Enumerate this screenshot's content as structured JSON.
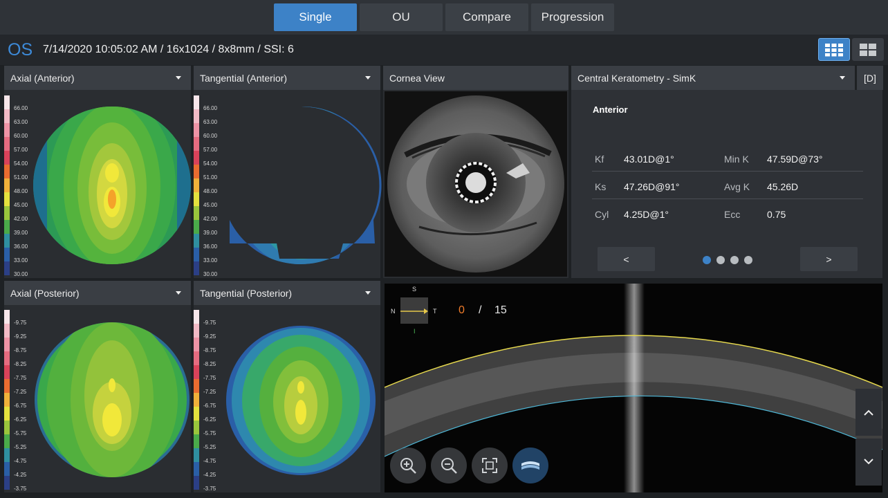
{
  "tabs": [
    {
      "label": "Single",
      "active": true
    },
    {
      "label": "OU",
      "active": false
    },
    {
      "label": "Compare",
      "active": false
    },
    {
      "label": "Progression",
      "active": false
    }
  ],
  "eye": "OS",
  "scan_info": "7/14/2020 10:05:02 AM / 16x1024 / 8x8mm / SSI: 6",
  "maps": {
    "axial_anterior": "Axial (Anterior)",
    "tangential_anterior": "Tangential (Anterior)",
    "axial_posterior": "Axial (Posterior)",
    "tangential_posterior": "Tangential (Posterior)"
  },
  "anterior_scale": [
    "66.00",
    "63.00",
    "60.00",
    "57.00",
    "54.00",
    "51.00",
    "48.00",
    "45.00",
    "42.00",
    "39.00",
    "36.00",
    "33.00",
    "30.00"
  ],
  "posterior_scale": [
    "-9.75",
    "-9.25",
    "-8.75",
    "-8.25",
    "-7.75",
    "-7.25",
    "-6.75",
    "-6.25",
    "-5.75",
    "-5.25",
    "-4.75",
    "-4.25",
    "-3.75"
  ],
  "cornea_view": "Cornea View",
  "keratometry": {
    "dropdown": "Central Keratometry - SimK",
    "d_button": "[D]",
    "section": "Anterior",
    "rows": [
      {
        "l1": "Kf",
        "v1": "43.01D@1°",
        "l2": "Min K",
        "v2": "47.59D@73°"
      },
      {
        "l1": "Ks",
        "v1": "47.26D@91°",
        "l2": "Avg K",
        "v2": "45.26D"
      },
      {
        "l1": "Cyl",
        "v1": "4.25D@1°",
        "l2": "Ecc",
        "v2": "0.75"
      }
    ],
    "prev": "<",
    "next": ">",
    "pages": 4,
    "active_page": 1
  },
  "oct": {
    "orientation": {
      "s": "S",
      "n": "N",
      "t": "T",
      "i": "I"
    },
    "current": "0",
    "separator": "/",
    "total": "15"
  },
  "colors": {
    "accent": "#3d82c7",
    "current_slice": "#f07c2a"
  }
}
